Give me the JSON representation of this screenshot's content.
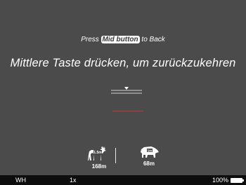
{
  "hint": {
    "prefix": "Press ",
    "key": "Mid button",
    "suffix": " to Back"
  },
  "headline": "Mittlere Taste drücken, um zurückzukehren",
  "animals": [
    {
      "icon": "deer-icon",
      "height_label": "1.5m",
      "distance": "168m"
    },
    {
      "icon": "boar-icon",
      "height_label": "1m",
      "distance": "68m"
    }
  ],
  "statusbar": {
    "palette": "WH",
    "zoom": "1x",
    "battery": "100%"
  },
  "colors": {
    "background": "#4b4b4b",
    "statusbar": "#0d0d0d",
    "redline": "#c23838"
  }
}
